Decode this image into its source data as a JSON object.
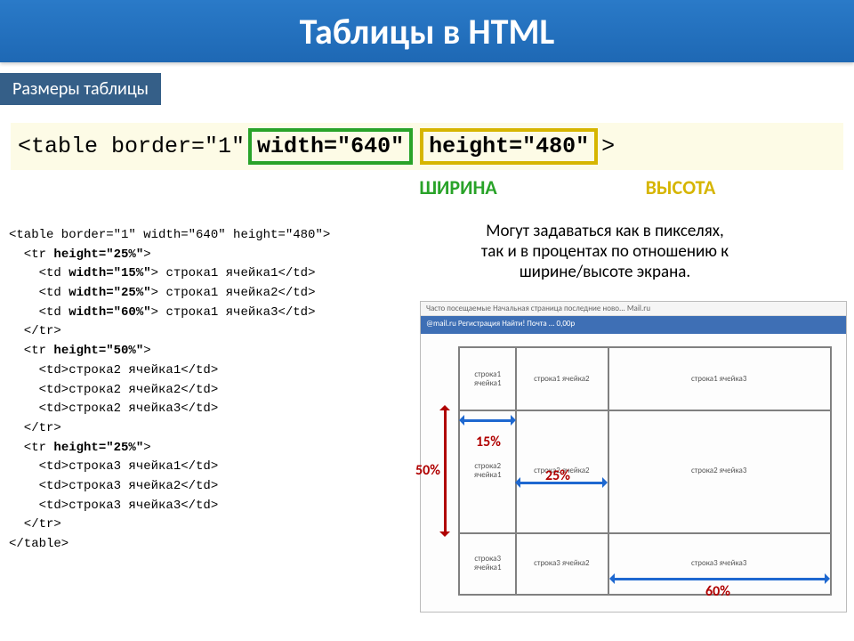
{
  "title": "Таблицы в HTML",
  "subtitle": "Размеры таблицы",
  "code_line": {
    "prefix": "<table border=\"1\"",
    "width_attr": "width=\"640\"",
    "height_attr": "height=\"480\"",
    "suffix": ">"
  },
  "labels": {
    "width": "ШИРИНА",
    "height": "ВЫСОТА"
  },
  "note_lines": [
    "Могут задаваться как в пикселях,",
    "так и в процентах по отношению к",
    "ширине/высоте экрана."
  ],
  "code_block": [
    "<table border=\"1\" width=\"640\" height=\"480\">",
    "  <tr height=\"25%\">",
    "    <td width=\"15%\"> строка1 ячейка1</td>",
    "    <td width=\"25%\"> строка1 ячейка2</td>",
    "    <td width=\"60%\"> строка1 ячейка3</td>",
    "  </tr>",
    "",
    "  <tr height=\"50%\">",
    "    <td>строка2 ячейка1</td>",
    "    <td>строка2 ячейка2</td>",
    "    <td>строка2 ячейка3</td>",
    "  </tr>",
    "",
    "  <tr height=\"25%\">",
    "    <td>строка3 ячейка1</td>",
    "    <td>строка3 ячейка2</td>",
    "    <td>строка3 ячейка3</td>",
    "  </tr>",
    "",
    "</table>"
  ],
  "code_bold_lines": [
    1,
    2,
    3,
    4,
    7,
    13
  ],
  "browser": {
    "toolbar1": "Часто посещаемые   Начальная страница   последние ново...   Mail.ru",
    "toolbar2": "@mail.ru    Регистрация     Найти!    Почта    ...  0,00р",
    "cells": [
      "строка1 ячейка1",
      "строка1 ячейка2",
      "строка1 ячейка3",
      "строка2 ячейка1",
      "строка2 ячейка2",
      "строка2 ячейка3",
      "строка3 ячейка1",
      "строка3 ячейка2",
      "строка3 ячейка3"
    ]
  },
  "annotations": {
    "w15": "15%",
    "w25": "25%",
    "w60": "60%",
    "h50": "50%"
  }
}
